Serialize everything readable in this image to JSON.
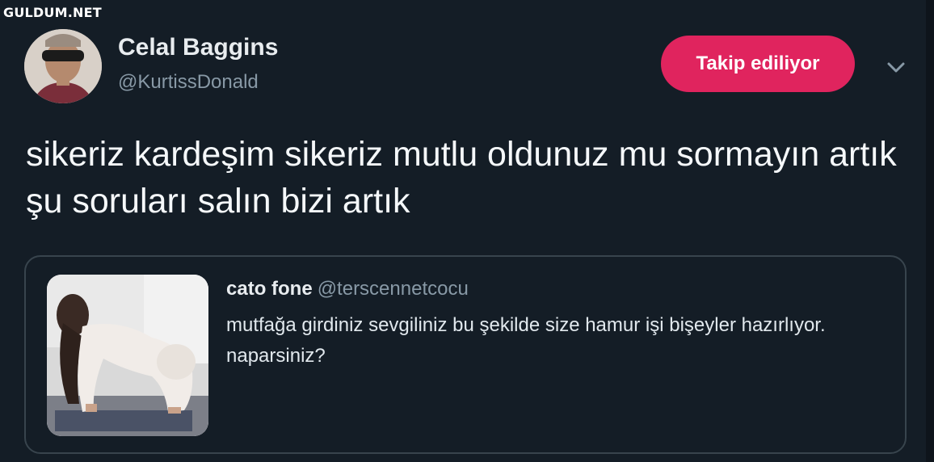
{
  "watermark": "GULDUM.NET",
  "tweet": {
    "author": {
      "display_name": "Celal Baggins",
      "handle": "@KurtissDonald"
    },
    "follow_button_label": "Takip ediliyor",
    "menu_icon": "chevron-down-icon",
    "text": "sikeriz kardeşim sikeriz mutlu oldunuz mu sormayın artık şu soruları salın bizi artık"
  },
  "quoted_tweet": {
    "display_name": "cato fone",
    "handle": "@terscennetcocu",
    "text": "mutfağa girdiniz sevgiliniz bu şekilde size hamur işi bişeyler hazırlıyor. naparsiniz?"
  },
  "colors": {
    "background": "#141d26",
    "follow_button": "#e0245e",
    "secondary_text": "#8899a6",
    "card_border": "#38444d"
  }
}
